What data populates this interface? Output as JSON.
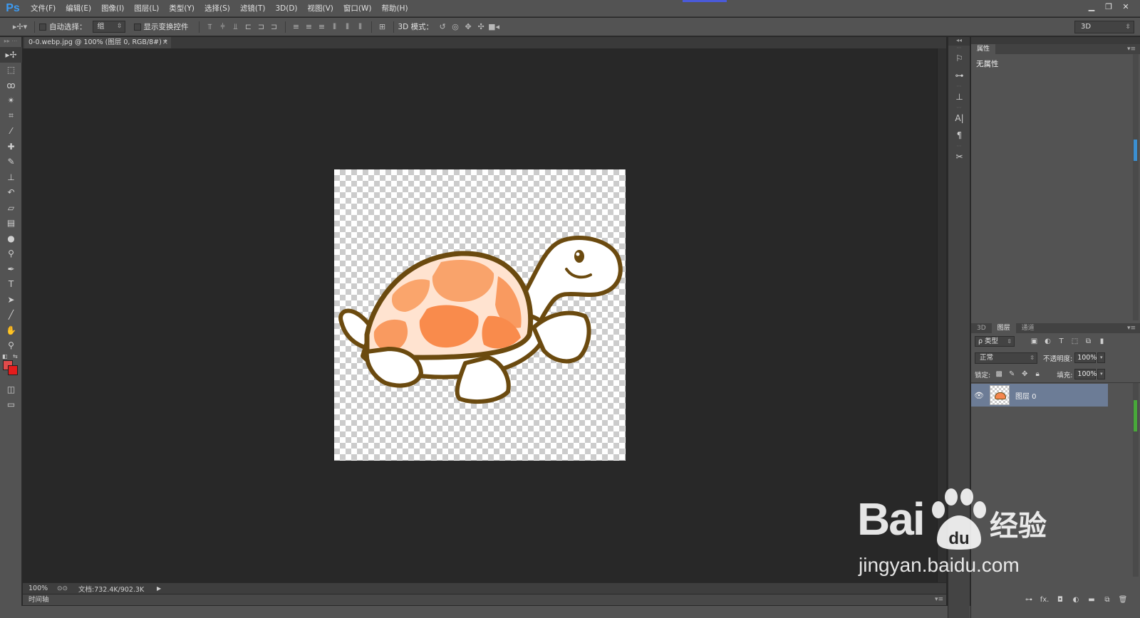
{
  "menubar": {
    "logo": "Ps",
    "items": [
      "文件(F)",
      "编辑(E)",
      "图像(I)",
      "图层(L)",
      "类型(Y)",
      "选择(S)",
      "滤镜(T)",
      "3D(D)",
      "视图(V)",
      "窗口(W)",
      "帮助(H)"
    ]
  },
  "optbar": {
    "auto_select_label": "自动选择：",
    "auto_select_value": "组",
    "show_transform_label": "显示变换控件",
    "mode_3d_label": "3D 模式：",
    "workspace": "3D"
  },
  "document": {
    "tab_title": "0-0.webp.jpg @ 100% (图层 0, RGB/8#) *",
    "close": "×"
  },
  "statusbar": {
    "zoom": "100%",
    "doc_info": "文档:732.4K/902.3K"
  },
  "timeline": {
    "label": "时间轴"
  },
  "properties": {
    "tab": "属性",
    "empty_text": "无属性"
  },
  "layers_panel": {
    "tabs": [
      "3D",
      "图层",
      "通道"
    ],
    "filter_label": "ρ 类型",
    "blend_mode": "正常",
    "opacity_label": "不透明度:",
    "opacity_value": "100%",
    "lock_label": "锁定:",
    "fill_label": "填充:",
    "fill_value": "100%",
    "layers": [
      {
        "name": "图层 0",
        "visible": true,
        "selected": true
      }
    ]
  },
  "watermark": {
    "brand": "Bai",
    "brand_du": "du",
    "product": "经验",
    "url": "jingyan.baidu.com"
  },
  "colors": {
    "foreground": "#e34b4b",
    "background": "#e31c1c",
    "selection": "#6c7c96"
  }
}
